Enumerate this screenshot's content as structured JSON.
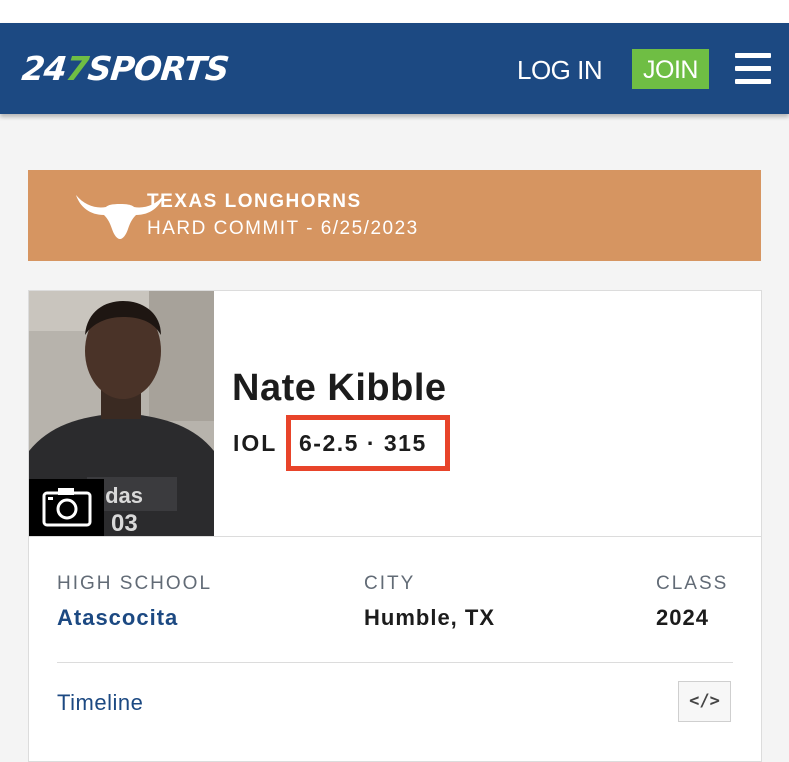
{
  "header": {
    "logo": {
      "part1": "24",
      "part2": "7",
      "part3": "SPORTS"
    },
    "login_label": "LOG IN",
    "join_label": "JOIN",
    "menu_icon": "hamburger-menu-icon"
  },
  "commitment": {
    "team": "TEXAS LONGHORNS",
    "status": "HARD COMMIT - 6/25/2023",
    "logo_icon": "longhorn-logo-icon",
    "background_color": "#d69561"
  },
  "player": {
    "name": "Nate Kibble",
    "position": "IOL",
    "measurements": "6-2.5 · 315",
    "photo_icon": "camera-icon",
    "jersey_text": {
      "brand": "idas",
      "number": "03"
    }
  },
  "details": {
    "high_school_label": "HIGH SCHOOL",
    "high_school": "Atascocita",
    "city_label": "CITY",
    "city": "Humble, TX",
    "class_label": "CLASS",
    "class": "2024"
  },
  "footer": {
    "timeline_label": "Timeline",
    "embed_label": "</>"
  },
  "colors": {
    "brand_blue": "#1c4982",
    "join_green": "#6fbe44",
    "highlight_red": "#e8442a"
  }
}
